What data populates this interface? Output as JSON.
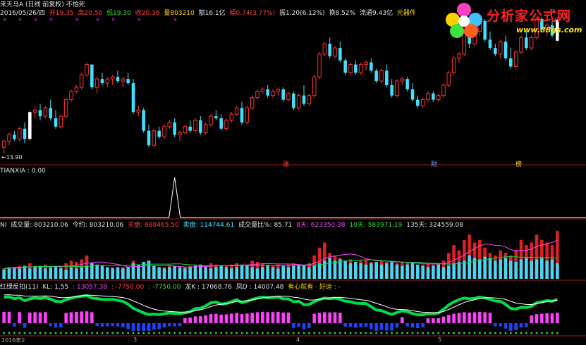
{
  "main_header": {
    "stock": "来天马A (日线 前复权) 不怕死",
    "date": "2016/05/26/四",
    "open": "开19.35",
    "high": "高20.50",
    "low": "低19.30",
    "close": "收20.36",
    "volume": "量803210",
    "amount": "额16.1亿",
    "change": "幅0.74(3.77%)",
    "amplitude": "振1.20(6.12%)",
    "turnover": "换8.52%",
    "float": "流通9.43亿",
    "element": "元器件"
  },
  "price_labels": {
    "low_marker": "←13.90"
  },
  "event_tags": [
    "涨",
    "财",
    "榜"
  ],
  "pane2_header": {
    "name": "TIANXIA : 0.00"
  },
  "pane3_header": {
    "prefix": "NI",
    "vol": "成交量: 803210.06",
    "today": "今约: 803210.06",
    "buy": "买盘: 688465.50",
    "sell": "卖盘: 114744.61",
    "ratio": "成交量比%: 85.71",
    "d8": "8天: 623350.38",
    "d10": "10天: 583971.19",
    "d135": "135天: 324559.08"
  },
  "pane4_header": {
    "name": "红绿反扣(11)",
    "kl": "KL: 1.55",
    "v1": ": 13057.38",
    "v2": ": -7750.00",
    "v3": ": -7750.00",
    "long": "龙K : 17068.76",
    "feng": "凤D : 14007.48",
    "msg": "有心就有 · 好运 : -"
  },
  "x_axis_labels": [
    "2016年2",
    "3",
    "4",
    "5"
  ],
  "logo": {
    "title": "分析家公式网",
    "url": "www.88gs.com"
  },
  "colors": {
    "up": "#ff3030",
    "down": "#40e0ff",
    "pane_border": "#9a2020",
    "kline_line": "#00dd44",
    "d_line": "#ffffff",
    "pos_bar": "#ff40ff",
    "neg_bar": "#2040ff"
  },
  "chart_data": {
    "type": "candlestick",
    "ylim": [
      13.9,
      20.5
    ],
    "candles": [
      [
        14.2,
        14.6,
        13.9,
        14.5
      ],
      [
        14.5,
        14.9,
        14.3,
        14.8
      ],
      [
        14.8,
        15.0,
        14.5,
        14.6
      ],
      [
        14.6,
        15.2,
        14.5,
        15.1
      ],
      [
        15.1,
        15.4,
        14.4,
        14.6
      ],
      [
        14.6,
        16.0,
        14.5,
        15.9
      ],
      [
        15.9,
        16.2,
        15.6,
        16.0
      ],
      [
        16.0,
        16.3,
        15.5,
        15.7
      ],
      [
        15.7,
        16.2,
        15.6,
        16.1
      ],
      [
        16.1,
        16.5,
        15.5,
        15.6
      ],
      [
        15.6,
        16.0,
        15.1,
        15.2
      ],
      [
        15.2,
        15.8,
        15.1,
        15.7
      ],
      [
        15.7,
        16.6,
        15.6,
        16.5
      ],
      [
        16.5,
        17.0,
        16.4,
        16.9
      ],
      [
        16.9,
        17.2,
        16.8,
        17.1
      ],
      [
        17.1,
        17.8,
        17.0,
        17.7
      ],
      [
        17.7,
        18.3,
        17.6,
        18.2
      ],
      [
        18.2,
        18.2,
        17.0,
        17.1
      ],
      [
        17.1,
        17.6,
        16.8,
        17.5
      ],
      [
        17.5,
        17.8,
        17.2,
        17.3
      ],
      [
        17.3,
        17.6,
        17.1,
        17.5
      ],
      [
        17.5,
        17.7,
        17.2,
        17.6
      ],
      [
        17.6,
        17.9,
        17.3,
        17.4
      ],
      [
        17.4,
        17.6,
        17.1,
        17.5
      ],
      [
        17.5,
        17.8,
        17.2,
        17.3
      ],
      [
        17.3,
        17.5,
        15.8,
        15.9
      ],
      [
        15.9,
        16.2,
        15.7,
        16.0
      ],
      [
        16.0,
        16.1,
        14.9,
        15.0
      ],
      [
        15.0,
        15.3,
        14.2,
        14.3
      ],
      [
        14.3,
        15.1,
        14.2,
        15.0
      ],
      [
        15.0,
        15.2,
        14.6,
        14.7
      ],
      [
        14.7,
        15.3,
        14.6,
        15.2
      ],
      [
        15.2,
        15.5,
        15.1,
        15.4
      ],
      [
        15.4,
        15.6,
        14.7,
        14.8
      ],
      [
        14.8,
        15.0,
        14.5,
        14.9
      ],
      [
        14.9,
        15.3,
        14.8,
        15.2
      ],
      [
        15.2,
        15.5,
        14.9,
        15.0
      ],
      [
        15.0,
        15.6,
        14.9,
        15.5
      ],
      [
        15.5,
        15.7,
        14.8,
        14.9
      ],
      [
        14.9,
        15.4,
        14.8,
        15.3
      ],
      [
        15.3,
        15.8,
        15.2,
        15.7
      ],
      [
        15.7,
        16.0,
        15.5,
        15.6
      ],
      [
        15.6,
        15.8,
        15.0,
        15.1
      ],
      [
        15.1,
        15.6,
        15.0,
        15.5
      ],
      [
        15.5,
        15.9,
        15.4,
        15.8
      ],
      [
        15.8,
        16.2,
        15.7,
        16.1
      ],
      [
        16.1,
        16.4,
        15.3,
        15.4
      ],
      [
        15.4,
        16.2,
        15.3,
        16.1
      ],
      [
        16.1,
        16.7,
        16.0,
        16.6
      ],
      [
        16.6,
        17.0,
        16.5,
        16.9
      ],
      [
        16.9,
        17.1,
        16.8,
        17.0
      ],
      [
        17.0,
        17.2,
        16.6,
        16.7
      ],
      [
        16.7,
        17.0,
        16.6,
        16.9
      ],
      [
        16.9,
        17.1,
        16.7,
        17.0
      ],
      [
        17.0,
        17.1,
        16.4,
        16.5
      ],
      [
        16.5,
        16.9,
        16.4,
        16.8
      ],
      [
        16.8,
        16.9,
        16.0,
        16.1
      ],
      [
        16.1,
        16.8,
        16.0,
        16.7
      ],
      [
        16.7,
        17.2,
        16.2,
        16.3
      ],
      [
        16.3,
        16.8,
        16.2,
        16.7
      ],
      [
        16.7,
        17.7,
        16.6,
        17.6
      ],
      [
        17.6,
        18.8,
        17.5,
        18.7
      ],
      [
        18.7,
        19.3,
        18.6,
        19.2
      ],
      [
        19.2,
        19.5,
        18.5,
        18.6
      ],
      [
        18.6,
        19.1,
        18.5,
        19.0
      ],
      [
        19.0,
        19.3,
        18.3,
        18.4
      ],
      [
        18.4,
        18.5,
        17.7,
        17.8
      ],
      [
        17.8,
        18.3,
        17.7,
        18.2
      ],
      [
        18.2,
        18.4,
        17.7,
        17.8
      ],
      [
        17.8,
        18.3,
        17.7,
        18.2
      ],
      [
        18.2,
        18.4,
        17.9,
        18.3
      ],
      [
        18.3,
        18.5,
        17.8,
        17.9
      ],
      [
        17.9,
        18.0,
        17.3,
        17.4
      ],
      [
        17.4,
        18.0,
        17.3,
        17.9
      ],
      [
        17.9,
        18.2,
        17.1,
        17.2
      ],
      [
        17.2,
        17.5,
        16.6,
        16.7
      ],
      [
        16.7,
        17.5,
        16.6,
        17.4
      ],
      [
        17.4,
        17.6,
        17.2,
        17.5
      ],
      [
        17.5,
        17.6,
        16.9,
        17.0
      ],
      [
        17.0,
        17.3,
        16.4,
        16.5
      ],
      [
        16.5,
        16.7,
        16.1,
        16.2
      ],
      [
        16.2,
        16.6,
        16.1,
        16.5
      ],
      [
        16.5,
        16.9,
        16.4,
        16.8
      ],
      [
        16.8,
        16.9,
        16.4,
        16.5
      ],
      [
        16.5,
        16.8,
        16.4,
        16.7
      ],
      [
        16.7,
        17.3,
        16.6,
        17.2
      ],
      [
        17.2,
        17.9,
        17.1,
        17.8
      ],
      [
        17.8,
        18.6,
        17.7,
        18.5
      ],
      [
        18.5,
        18.8,
        18.3,
        18.7
      ],
      [
        18.7,
        19.8,
        18.6,
        19.7
      ],
      [
        19.7,
        20.4,
        19.0,
        19.2
      ],
      [
        19.2,
        19.9,
        19.1,
        19.8
      ],
      [
        19.8,
        20.4,
        19.6,
        20.3
      ],
      [
        20.3,
        20.4,
        19.3,
        19.4
      ],
      [
        19.4,
        19.8,
        18.9,
        19.0
      ],
      [
        19.0,
        19.2,
        18.6,
        18.7
      ],
      [
        18.7,
        19.4,
        18.5,
        19.3
      ],
      [
        19.3,
        19.6,
        18.4,
        18.5
      ],
      [
        18.5,
        19.0,
        18.0,
        18.1
      ],
      [
        18.1,
        18.9,
        18.0,
        18.8
      ],
      [
        18.8,
        19.6,
        18.7,
        19.5
      ],
      [
        19.5,
        19.8,
        18.9,
        19.0
      ],
      [
        19.0,
        19.6,
        18.9,
        19.5
      ],
      [
        19.5,
        20.5,
        19.4,
        20.4
      ],
      [
        20.4,
        20.5,
        19.8,
        19.9
      ],
      [
        19.9,
        20.2,
        19.6,
        20.1
      ],
      [
        20.1,
        20.3,
        19.5,
        19.6
      ],
      [
        19.35,
        20.5,
        19.3,
        20.36
      ]
    ],
    "volume_buy": [
      8,
      9,
      7,
      10,
      9,
      12,
      10,
      9,
      11,
      8,
      7,
      9,
      12,
      14,
      13,
      15,
      18,
      12,
      10,
      9,
      8,
      9,
      8,
      9,
      8,
      14,
      10,
      12,
      11,
      9,
      8,
      9,
      10,
      9,
      8,
      9,
      10,
      11,
      9,
      10,
      12,
      11,
      9,
      10,
      11,
      12,
      10,
      11,
      14,
      13,
      12,
      11,
      10,
      11,
      10,
      11,
      12,
      11,
      10,
      12,
      18,
      24,
      28,
      20,
      18,
      16,
      14,
      15,
      13,
      14,
      15,
      13,
      12,
      14,
      13,
      11,
      12,
      13,
      12,
      11,
      10,
      11,
      12,
      11,
      12,
      14,
      20,
      26,
      22,
      30,
      34,
      28,
      30,
      24,
      20,
      18,
      22,
      20,
      18,
      22,
      30,
      26,
      28,
      34,
      30,
      28,
      26,
      37
    ],
    "volume_sell": [
      7,
      8,
      9,
      8,
      10,
      8,
      9,
      10,
      8,
      9,
      10,
      8,
      7,
      9,
      8,
      9,
      10,
      12,
      11,
      10,
      9,
      8,
      9,
      8,
      9,
      12,
      11,
      13,
      14,
      10,
      9,
      8,
      9,
      10,
      9,
      8,
      9,
      10,
      11,
      9,
      8,
      9,
      10,
      9,
      8,
      9,
      11,
      10,
      9,
      8,
      9,
      10,
      9,
      8,
      10,
      9,
      10,
      11,
      10,
      9,
      10,
      12,
      14,
      16,
      14,
      15,
      14,
      12,
      13,
      12,
      11,
      12,
      13,
      11,
      12,
      13,
      11,
      10,
      11,
      12,
      11,
      10,
      9,
      10,
      11,
      9,
      10,
      12,
      13,
      14,
      18,
      16,
      15,
      17,
      16,
      14,
      15,
      16,
      14,
      13,
      15,
      16,
      14,
      15,
      16,
      14,
      15,
      12
    ]
  }
}
